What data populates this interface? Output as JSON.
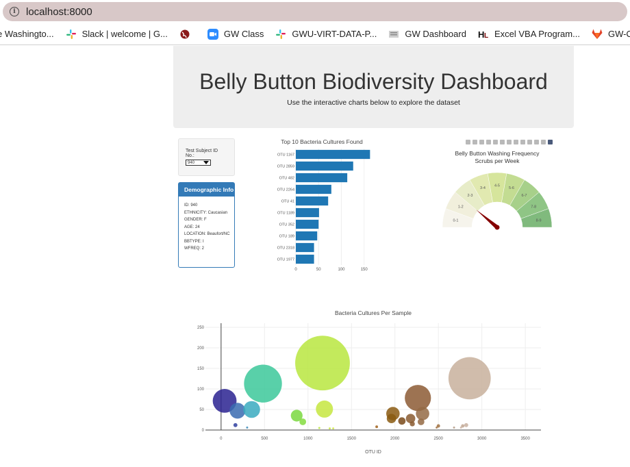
{
  "browser": {
    "url": "localhost:8000",
    "bookmarks": [
      {
        "label": "e Washingto...",
        "icon": "none"
      },
      {
        "label": "Slack | welcome | G...",
        "icon": "slack-icon",
        "color": "#36c5f0"
      },
      {
        "label": "",
        "icon": "globe-icon",
        "color": "#8b1a1a"
      },
      {
        "label": "GW Class",
        "icon": "zoom-icon",
        "color": "#2d8cff"
      },
      {
        "label": "GWU-VIRT-DATA-P...",
        "icon": "slack-icon",
        "color": "#36c5f0"
      },
      {
        "label": "GW Dashboard",
        "icon": "page-icon",
        "color": "#9e9e9e"
      },
      {
        "label": "Excel VBA Program...",
        "icon": "hl-icon",
        "color": "#7a0000"
      },
      {
        "label": "GW-Coding-Boot-",
        "icon": "gitlab-icon",
        "color": "#e24329"
      }
    ]
  },
  "header": {
    "title": "Belly Button Biodiversity Dashboard",
    "subtitle": "Use the interactive charts below to explore the dataset"
  },
  "selector": {
    "label": "Test Subject ID No.:",
    "value": "940"
  },
  "demographic": {
    "heading": "Demographic Info",
    "lines": [
      "ID: 940",
      "ETHNICITY: Caucasian",
      "GENDER: F",
      "AGE: 24",
      "LOCATION: Beaufort/NC",
      "BBTYPE: I",
      "WFREQ: 2"
    ]
  },
  "chart_data": [
    {
      "type": "bar",
      "orientation": "horizontal",
      "title": "Top 10 Bacteria Cultures Found",
      "categories": [
        "OTU 1167",
        "OTU 2859",
        "OTU 482",
        "OTU 2264",
        "OTU 41",
        "OTU 1189",
        "OTU 352",
        "OTU 189",
        "OTU 2318",
        "OTU 1977"
      ],
      "category_labels": [
        "OTU 1167",
        "OTU 2859",
        "OTU 482",
        "OTU 2264",
        "OTU 41",
        "OTU 1189",
        "OTU 352",
        "OTU 189",
        "OTU 2318",
        "OTU 1977"
      ],
      "values": [
        163,
        126,
        113,
        78,
        71,
        51,
        50,
        47,
        40,
        40
      ],
      "xlim": [
        0,
        170
      ],
      "xticks": [
        0,
        50,
        100,
        150
      ],
      "color": "#1f77b4"
    },
    {
      "type": "gauge",
      "title": "Belly Button Washing Frequency",
      "subtitle": "Scrubs per Week",
      "sectors": [
        "0-1",
        "1-2",
        "2-3",
        "3-4",
        "4-5",
        "5-6",
        "6-7",
        "7-8",
        "8-9"
      ],
      "sector_colors": [
        "#f6f4ec",
        "#f1efdc",
        "#e7ecc8",
        "#e1e9b0",
        "#d6e59c",
        "#c3dc92",
        "#a7d08a",
        "#8fc585",
        "#80ba7d"
      ],
      "value": 2,
      "range": [
        0,
        9
      ],
      "needle_color": "#850000"
    },
    {
      "type": "scatter",
      "title": "Bacteria Cultures Per Sample",
      "xlabel": "OTU ID",
      "xlim": [
        -180,
        3680
      ],
      "ylim": [
        0,
        260
      ],
      "xticks": [
        0,
        500,
        1000,
        1500,
        2000,
        2500,
        3000,
        3500
      ],
      "yticks": [
        0,
        50,
        100,
        150,
        200,
        250
      ],
      "points": [
        {
          "x": 41,
          "y": 71,
          "size": 71,
          "color": "#2a2290"
        },
        {
          "x": 189,
          "y": 47,
          "size": 47,
          "color": "#3a6bb0"
        },
        {
          "x": 352,
          "y": 50,
          "size": 50,
          "color": "#3aaac0"
        },
        {
          "x": 482,
          "y": 113,
          "size": 113,
          "color": "#3cc89a"
        },
        {
          "x": 870,
          "y": 35,
          "size": 35,
          "color": "#7ad840"
        },
        {
          "x": 940,
          "y": 20,
          "size": 20,
          "color": "#84dc40"
        },
        {
          "x": 1167,
          "y": 163,
          "size": 163,
          "color": "#b8e640"
        },
        {
          "x": 1189,
          "y": 51,
          "size": 51,
          "color": "#c6e640"
        },
        {
          "x": 1977,
          "y": 40,
          "size": 40,
          "color": "#8b5a12"
        },
        {
          "x": 1960,
          "y": 28,
          "size": 28,
          "color": "#8a5a10"
        },
        {
          "x": 2080,
          "y": 22,
          "size": 22,
          "color": "#7a4a1a"
        },
        {
          "x": 2180,
          "y": 28,
          "size": 28,
          "color": "#8a5a30"
        },
        {
          "x": 2200,
          "y": 15,
          "size": 15,
          "color": "#8a5a30"
        },
        {
          "x": 2264,
          "y": 78,
          "size": 78,
          "color": "#8c5a34"
        },
        {
          "x": 2318,
          "y": 40,
          "size": 40,
          "color": "#946a44"
        },
        {
          "x": 2300,
          "y": 20,
          "size": 20,
          "color": "#946a44"
        },
        {
          "x": 2859,
          "y": 126,
          "size": 126,
          "color": "#c8b09c"
        },
        {
          "x": 1790,
          "y": 8,
          "size": 8,
          "color": "#a0601a"
        },
        {
          "x": 2500,
          "y": 10,
          "size": 10,
          "color": "#a07040"
        },
        {
          "x": 2480,
          "y": 6,
          "size": 6,
          "color": "#a07040"
        },
        {
          "x": 2680,
          "y": 6,
          "size": 6,
          "color": "#b49a86"
        },
        {
          "x": 2780,
          "y": 10,
          "size": 10,
          "color": "#c0a490"
        },
        {
          "x": 2820,
          "y": 12,
          "size": 12,
          "color": "#c8b0a0"
        },
        {
          "x": 2760,
          "y": 6,
          "size": 6,
          "color": "#c8b0a0"
        },
        {
          "x": 165,
          "y": 12,
          "size": 12,
          "color": "#3040a0"
        },
        {
          "x": 300,
          "y": 6,
          "size": 6,
          "color": "#3a8ab8"
        },
        {
          "x": 1130,
          "y": 5,
          "size": 5,
          "color": "#b8e640"
        },
        {
          "x": 1250,
          "y": 4,
          "size": 4,
          "color": "#c8e640"
        },
        {
          "x": 1290,
          "y": 4,
          "size": 4,
          "color": "#d0e648"
        }
      ]
    }
  ]
}
